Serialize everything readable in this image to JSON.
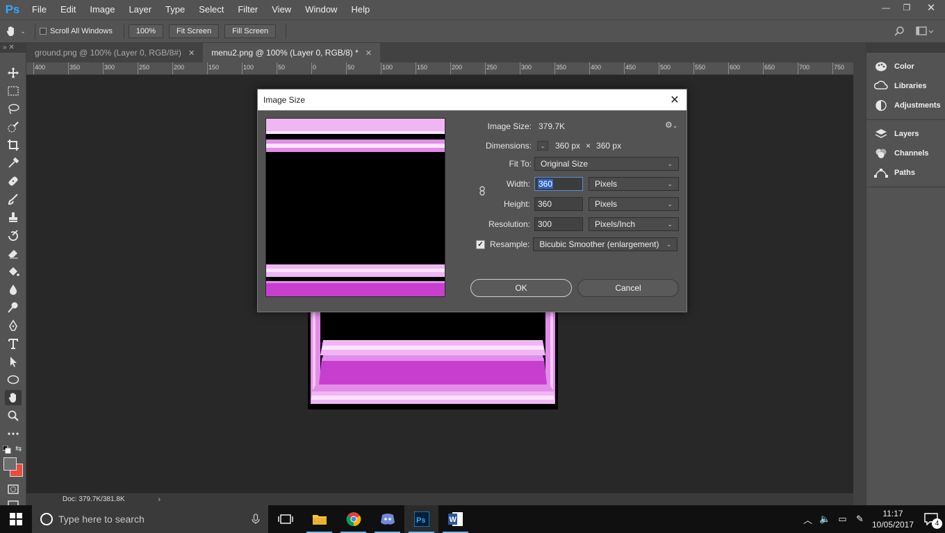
{
  "app": {
    "logo": "Ps",
    "menu": [
      "File",
      "Edit",
      "Image",
      "Layer",
      "Type",
      "Select",
      "Filter",
      "View",
      "Window",
      "Help"
    ],
    "window_controls": {
      "minimize": "—",
      "restore": "❐",
      "close": "✕"
    }
  },
  "options_bar": {
    "scroll_all_windows": "Scroll All Windows",
    "zoom_100": "100%",
    "fit_screen": "Fit Screen",
    "fill_screen": "Fill Screen"
  },
  "tabs": [
    {
      "label": "ground.png @ 100% (Layer 0, RGB/8#)",
      "close": "✕",
      "active": false
    },
    {
      "label": "menu2.png @ 100% (Layer 0, RGB/8) *",
      "close": "✕",
      "active": true
    }
  ],
  "ruler": {
    "ticks": [
      "400",
      "350",
      "300",
      "250",
      "200",
      "150",
      "100",
      "50",
      "0",
      "50",
      "100",
      "150",
      "200",
      "250",
      "300",
      "350",
      "400",
      "450",
      "500",
      "550",
      "600",
      "650",
      "700",
      "750"
    ]
  },
  "status": {
    "doc_info": "Doc: 379.7K/381.8K",
    "arrow": "›"
  },
  "panels": {
    "group1": [
      "Color",
      "Libraries",
      "Adjustments"
    ],
    "group2": [
      "Layers",
      "Channels",
      "Paths"
    ]
  },
  "dialog": {
    "title": "Image Size",
    "close": "✕",
    "image_size_label": "Image Size:",
    "image_size_value": "379.7K",
    "dimensions_label": "Dimensions:",
    "dimensions_w": "360 px",
    "dimensions_x": "×",
    "dimensions_h": "360 px",
    "fit_to_label": "Fit To:",
    "fit_to_value": "Original Size",
    "width_label": "Width:",
    "width_value": "360",
    "width_unit": "Pixels",
    "height_label": "Height:",
    "height_value": "360",
    "height_unit": "Pixels",
    "resolution_label": "Resolution:",
    "resolution_value": "300",
    "resolution_unit": "Pixels/Inch",
    "resample_label": "Resample:",
    "resample_checked": true,
    "resample_value": "Bicubic Smoother (enlargement)",
    "ok": "OK",
    "cancel": "Cancel"
  },
  "taskbar": {
    "search_placeholder": "Type here to search",
    "clock_time": "11:17",
    "clock_date": "10/05/2017",
    "notification_count": "4"
  },
  "colors": {
    "accent_blue": "#31a8ff",
    "highlight": "#2c64c9",
    "pink_light": "#f0b6f4",
    "pink_mid": "#e28ee9",
    "magenta": "#c83fcf",
    "foreground_swatch": "#6e6e6e",
    "background_swatch": "#e74c3c"
  }
}
